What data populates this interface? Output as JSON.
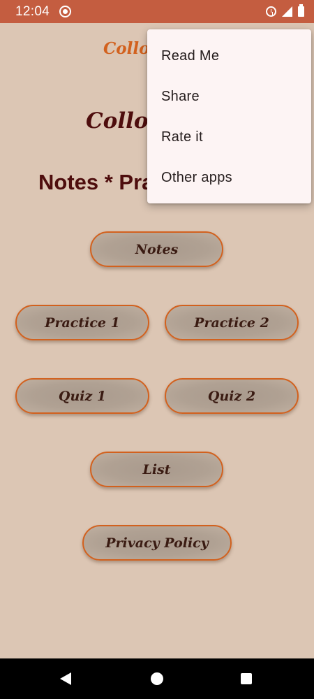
{
  "status_bar": {
    "time": "12:04",
    "icons": [
      "app-notification-icon",
      "alarm-icon",
      "signal-icon",
      "battery-icon"
    ],
    "background_color": "#c45d40"
  },
  "app": {
    "title_small": "Collo",
    "title_large": "Colloc",
    "subtitle": "Notes * Pra",
    "background_color": "#dcc6b4",
    "accent_color": "#d2611e"
  },
  "buttons": {
    "notes": "Notes",
    "practice1": "Practice 1",
    "practice2": "Practice 2",
    "quiz1": "Quiz 1",
    "quiz2": "Quiz 2",
    "list": "List",
    "privacy_policy": "Privacy Policy"
  },
  "menu": {
    "items": [
      "Read Me",
      "Share",
      "Rate it",
      "Other apps"
    ]
  },
  "nav_bar": {
    "icons": [
      "back-icon",
      "home-icon",
      "recents-icon"
    ]
  }
}
